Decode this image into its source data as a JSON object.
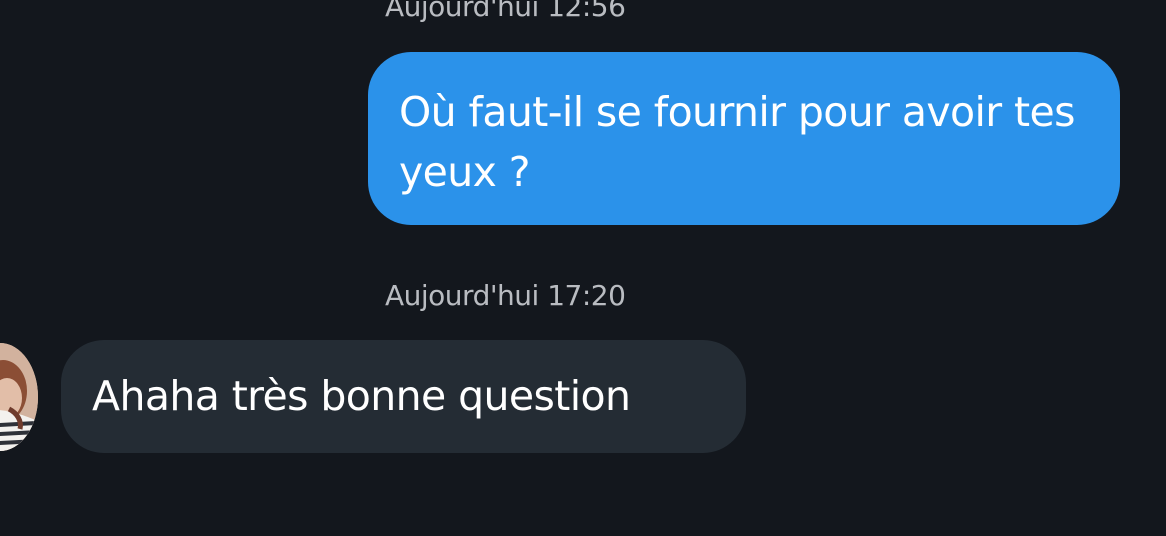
{
  "conversation": {
    "messages": [
      {
        "timestamp": "Aujourd'hui 12:56",
        "direction": "outgoing",
        "text": "Où faut-il se fournir pour avoir tes yeux ?"
      },
      {
        "timestamp": "Aujourd'hui 17:20",
        "direction": "incoming",
        "text": "Ahaha très bonne question",
        "avatar_icon": "contact-avatar"
      }
    ]
  },
  "colors": {
    "background": "#13171d",
    "outgoing_bubble": "#2b92ea",
    "incoming_bubble": "#242c34",
    "timestamp_text": "#b9bcc1",
    "message_text": "#ffffff"
  }
}
